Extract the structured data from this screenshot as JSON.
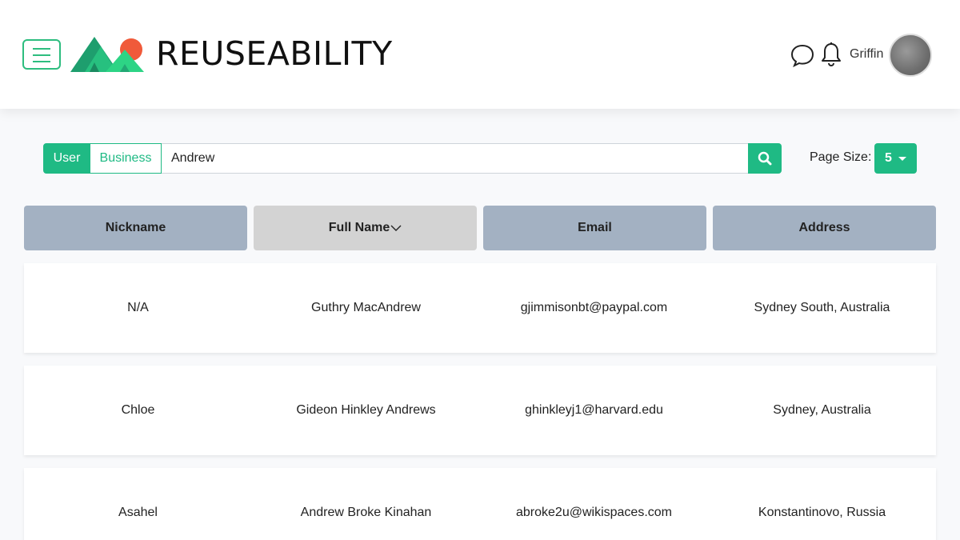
{
  "header": {
    "brand": "REUSEABILITY",
    "username": "Griffin",
    "icons": {
      "menu": "hamburger-menu-icon",
      "chat": "chat-bubble-icon",
      "notifications": "bell-icon"
    }
  },
  "search": {
    "toggle_user": "User",
    "toggle_business": "Business",
    "value": "Andrew",
    "page_size_label": "Page Size:",
    "page_size_value": "5"
  },
  "table": {
    "columns": [
      "Nickname",
      "Full Name",
      "Email",
      "Address"
    ],
    "sorted_column": "Full Name",
    "rows": [
      {
        "nickname": "N/A",
        "full_name": "Guthry MacAndrew",
        "email": "gjimmisonbt@paypal.com",
        "address": "Sydney South, Australia"
      },
      {
        "nickname": "Chloe",
        "full_name": "Gideon Hinkley Andrews",
        "email": "ghinkleyj1@harvard.edu",
        "address": "Sydney, Australia"
      },
      {
        "nickname": "Asahel",
        "full_name": "Andrew Broke Kinahan",
        "email": "abroke2u@wikispaces.com",
        "address": "Konstantinovo, Russia"
      }
    ]
  },
  "colors": {
    "accent": "#1fba84",
    "header_cell": "#a3b1c2",
    "header_cell_active": "#d3d3d3"
  }
}
